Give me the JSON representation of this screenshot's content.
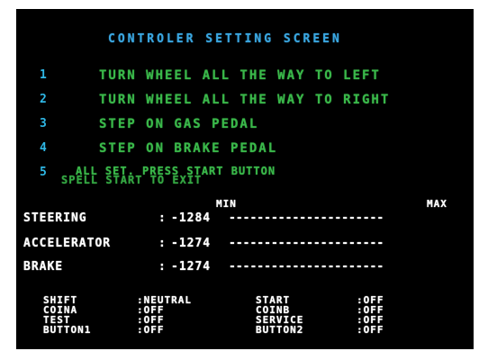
{
  "title": "CONTROLER SETTING SCREEN",
  "steps": [
    {
      "num": "1",
      "text": "TURN WHEEL ALL THE WAY TO LEFT"
    },
    {
      "num": "2",
      "text": "TURN WHEEL ALL THE WAY TO RIGHT"
    },
    {
      "num": "3",
      "text": "STEP ON GAS PEDAL"
    },
    {
      "num": "4",
      "text": "STEP ON BRAKE PEDAL"
    },
    {
      "num": "5",
      "text": "ALL SET. PRESS START BUTTON"
    },
    {
      "num": "",
      "text": "SPELL START TO EXIT"
    }
  ],
  "range": {
    "min": "MIN",
    "max": "MAX"
  },
  "axes": [
    {
      "name": "STEERING",
      "sep": ":",
      "value": "-1284",
      "bar": "----------------------"
    },
    {
      "name": "ACCELERATOR",
      "sep": ":",
      "value": "-1274",
      "bar": "----------------------"
    },
    {
      "name": "BRAKE",
      "sep": ":",
      "value": "-1274",
      "bar": "----------------------"
    }
  ],
  "switches_left": [
    {
      "name": "SHIFT",
      "value": ":NEUTRAL"
    },
    {
      "name": "COINA",
      "value": ":OFF"
    },
    {
      "name": "TEST",
      "value": ":OFF"
    },
    {
      "name": "BUTTON1",
      "value": ":OFF"
    }
  ],
  "switches_right": [
    {
      "name": "START",
      "value": ":OFF"
    },
    {
      "name": "COINB",
      "value": ":OFF"
    },
    {
      "name": "SERVICE",
      "value": ":OFF"
    },
    {
      "name": "BUTTON2",
      "value": ":OFF"
    }
  ],
  "colors": {
    "title": "#3aa6e0",
    "steps": "#3ab84a",
    "numbers": "#2fb8e6",
    "data": "#ffffff"
  }
}
